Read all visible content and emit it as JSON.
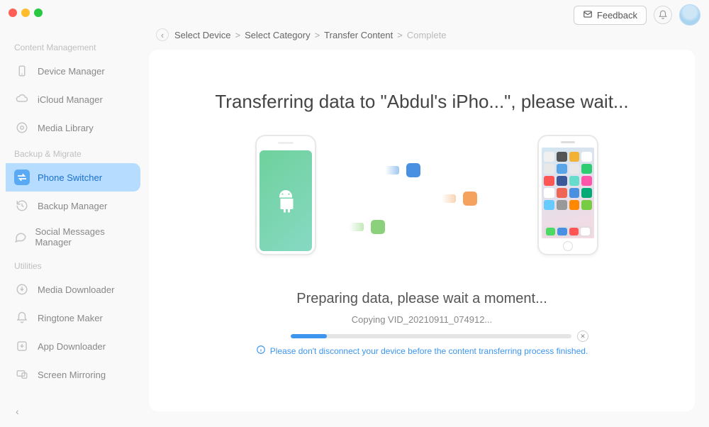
{
  "topbar": {
    "feedback_label": "Feedback"
  },
  "sidebar": {
    "sections": [
      {
        "label": "Content Management",
        "items": [
          {
            "label": "Device Manager",
            "icon": "device-icon"
          },
          {
            "label": "iCloud Manager",
            "icon": "cloud-icon"
          },
          {
            "label": "Media Library",
            "icon": "disc-icon"
          }
        ]
      },
      {
        "label": "Backup & Migrate",
        "items": [
          {
            "label": "Phone Switcher",
            "icon": "switcher-icon",
            "active": true
          },
          {
            "label": "Backup Manager",
            "icon": "history-icon"
          },
          {
            "label": "Social Messages Manager",
            "icon": "chat-icon"
          }
        ]
      },
      {
        "label": "Utilities",
        "items": [
          {
            "label": "Media Downloader",
            "icon": "download-icon"
          },
          {
            "label": "Ringtone Maker",
            "icon": "bell-outline-icon"
          },
          {
            "label": "App Downloader",
            "icon": "app-download-icon"
          },
          {
            "label": "Screen Mirroring",
            "icon": "mirror-icon"
          }
        ]
      }
    ]
  },
  "breadcrumb": {
    "items": [
      {
        "label": "Select Device",
        "dim": false
      },
      {
        "label": "Select Category",
        "dim": false
      },
      {
        "label": "Transfer Content",
        "dim": false
      },
      {
        "label": "Complete",
        "dim": true
      }
    ]
  },
  "transfer": {
    "title": "Transferring data to \"Abdul's iPho...\", please wait...",
    "preparing": "Preparing data, please wait a moment...",
    "copying": "Copying VID_20210911_074912...",
    "progress_percent": 13,
    "warning": "Please don't disconnect your device before the content transferring process finished."
  },
  "ios_apps_row1": [
    "#f0f0f0",
    "#555",
    "#f2b233",
    "#fff"
  ],
  "ios_apps_row2": [
    "#e8e8e8",
    "#5aa5e8",
    "#e8e8e8",
    "#2dcc70"
  ],
  "ios_apps_row3": [
    "#f55",
    "#3b5998",
    "#6dc",
    "#f5a"
  ],
  "ios_apps_row4": [
    "#fff",
    "#e65",
    "#4a90e2",
    "#0a7"
  ],
  "ios_apps_row5": [
    "#6cf",
    "#999",
    "#f80",
    "#7c4"
  ],
  "ios_dock": [
    "#4dd964",
    "#4a90e2",
    "#f55",
    "#fff"
  ]
}
